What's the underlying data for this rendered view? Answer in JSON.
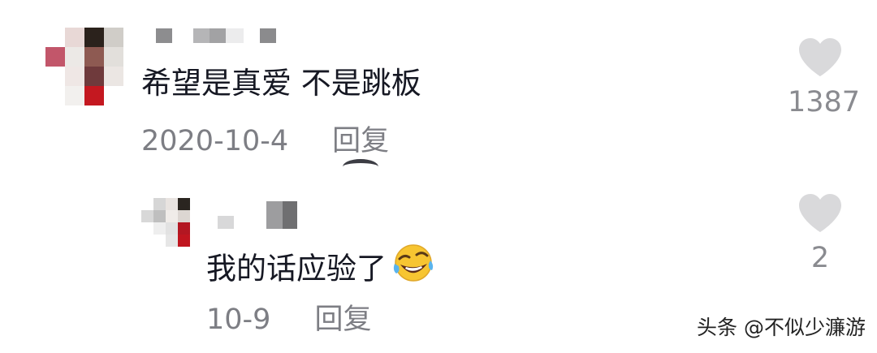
{
  "comments": [
    {
      "text": "希望是真爱 不是跳板",
      "date": "2020-10-4",
      "reply_label": "回复",
      "likes": "1387"
    },
    {
      "text": "我的话应验了",
      "emoji_icon": "laughing-crying-emoji",
      "date": "10-9",
      "reply_label": "回复",
      "likes": "2"
    }
  ],
  "watermark": "头条 @不似少濂游",
  "colors": {
    "primary_text": "#161823",
    "secondary_text": "#7d7e84",
    "like_icon": "#d9d9db"
  }
}
